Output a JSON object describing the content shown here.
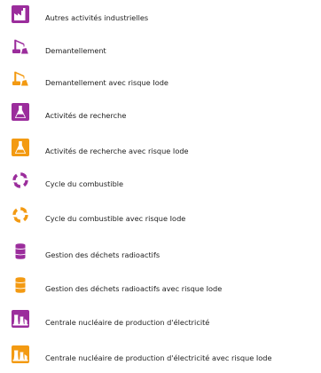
{
  "colors": {
    "purple": "#9b2d9c",
    "orange": "#f39a12",
    "white": "#ffffff"
  },
  "legend": {
    "items": [
      {
        "label": "Autres activités industrielles",
        "icon": "factory-icon",
        "variant": "purple"
      },
      {
        "label": "Demantellement",
        "icon": "crane-icon",
        "variant": "purple"
      },
      {
        "label": "Demantellement avec risque Iode",
        "icon": "crane-icon",
        "variant": "orange"
      },
      {
        "label": "Activités de recherche",
        "icon": "flask-icon",
        "variant": "purple"
      },
      {
        "label": "Activités de recherche avec risque Iode",
        "icon": "flask-icon",
        "variant": "orange"
      },
      {
        "label": "Cycle du combustible",
        "icon": "recycle-icon",
        "variant": "purple"
      },
      {
        "label": "Cycle du combustible avec risque Iode",
        "icon": "recycle-icon",
        "variant": "orange"
      },
      {
        "label": "Gestion des déchets radioactifs",
        "icon": "barrel-icon",
        "variant": "purple"
      },
      {
        "label": "Gestion des déchets radioactifs avec risque Iode",
        "icon": "barrel-icon",
        "variant": "orange"
      },
      {
        "label": "Centrale nucléaire de production d'électricité",
        "icon": "power-plant-icon",
        "variant": "purple"
      },
      {
        "label": "Centrale nucléaire de production d'électricité avec risque Iode",
        "icon": "power-plant-icon",
        "variant": "orange"
      }
    ]
  }
}
